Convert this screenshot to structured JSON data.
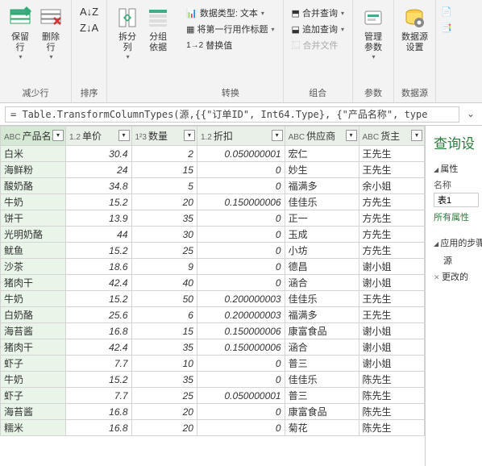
{
  "ribbon": {
    "groups": {
      "reduce": {
        "label": "减少行",
        "keep": "保留\n行",
        "remove": "删除\n行"
      },
      "sort": {
        "label": "排序"
      },
      "split": {
        "label": "",
        "splitcol": "拆分\n列",
        "groupby": "分组\n依据"
      },
      "transform": {
        "label": "转换",
        "datatype_prefix": "数据类型:",
        "datatype_value": "文本",
        "firstrow": "将第一行用作标题",
        "replace_prefix": "1",
        "replace": "替换值"
      },
      "combine": {
        "label": "组合",
        "merge": "合并查询",
        "append": "追加查询",
        "combinefiles": "合并文件"
      },
      "params": {
        "label": "参数",
        "manage": "管理\n参数"
      },
      "datasource": {
        "label": "数据源",
        "settings": "数据源\n设置"
      }
    }
  },
  "formula": {
    "text": "= Table.TransformColumnTypes(源,{{\"订单ID\", Int64.Type}, {\"产品名称\", type"
  },
  "columns": {
    "product": {
      "type": "ABC",
      "name": "产品名..."
    },
    "price": {
      "type": "1.2",
      "name": "单价"
    },
    "qty": {
      "type": "1²3",
      "name": "数量"
    },
    "discount": {
      "type": "1.2",
      "name": "折扣"
    },
    "supplier": {
      "type": "ABC",
      "name": "供应商"
    },
    "owner": {
      "type": "ABC",
      "name": "货主"
    }
  },
  "rows": [
    {
      "p": "白米",
      "price": "30.4",
      "q": "2",
      "d": "0.050000001",
      "s": "宏仁",
      "o": "王先生"
    },
    {
      "p": "海鲜粉",
      "price": "24",
      "q": "15",
      "d": "0",
      "s": "妙生",
      "o": "王先生"
    },
    {
      "p": "酸奶酪",
      "price": "34.8",
      "q": "5",
      "d": "0",
      "s": "福满多",
      "o": "余小姐"
    },
    {
      "p": "牛奶",
      "price": "15.2",
      "q": "20",
      "d": "0.150000006",
      "s": "佳佳乐",
      "o": "方先生"
    },
    {
      "p": "饼干",
      "price": "13.9",
      "q": "35",
      "d": "0",
      "s": "正一",
      "o": "方先生"
    },
    {
      "p": "光明奶酪",
      "price": "44",
      "q": "30",
      "d": "0",
      "s": "玉成",
      "o": "方先生"
    },
    {
      "p": "鱿鱼",
      "price": "15.2",
      "q": "25",
      "d": "0",
      "s": "小坊",
      "o": "方先生"
    },
    {
      "p": "沙茶",
      "price": "18.6",
      "q": "9",
      "d": "0",
      "s": "德昌",
      "o": "谢小姐"
    },
    {
      "p": "猪肉干",
      "price": "42.4",
      "q": "40",
      "d": "0",
      "s": "涵合",
      "o": "谢小姐"
    },
    {
      "p": "牛奶",
      "price": "15.2",
      "q": "50",
      "d": "0.200000003",
      "s": "佳佳乐",
      "o": "王先生"
    },
    {
      "p": "白奶酪",
      "price": "25.6",
      "q": "6",
      "d": "0.200000003",
      "s": "福满多",
      "o": "王先生"
    },
    {
      "p": "海苔酱",
      "price": "16.8",
      "q": "15",
      "d": "0.150000006",
      "s": "康富食品",
      "o": "谢小姐"
    },
    {
      "p": "猪肉干",
      "price": "42.4",
      "q": "35",
      "d": "0.150000006",
      "s": "涵合",
      "o": "谢小姐"
    },
    {
      "p": "虾子",
      "price": "7.7",
      "q": "10",
      "d": "0",
      "s": "普三",
      "o": "谢小姐"
    },
    {
      "p": "牛奶",
      "price": "15.2",
      "q": "35",
      "d": "0",
      "s": "佳佳乐",
      "o": "陈先生"
    },
    {
      "p": "虾子",
      "price": "7.7",
      "q": "25",
      "d": "0.050000001",
      "s": "普三",
      "o": "陈先生"
    },
    {
      "p": "海苔酱",
      "price": "16.8",
      "q": "20",
      "d": "0",
      "s": "康富食品",
      "o": "陈先生"
    },
    {
      "p": "糯米",
      "price": "16.8",
      "q": "20",
      "d": "0",
      "s": "菊花",
      "o": "陈先生"
    }
  ],
  "side": {
    "title": "查询设",
    "props_head": "属性",
    "name_label": "名称",
    "name_value": "表1",
    "all_props": "所有属性",
    "steps_head": "应用的步骤",
    "step_source": "源",
    "step_changed": "更改的"
  }
}
